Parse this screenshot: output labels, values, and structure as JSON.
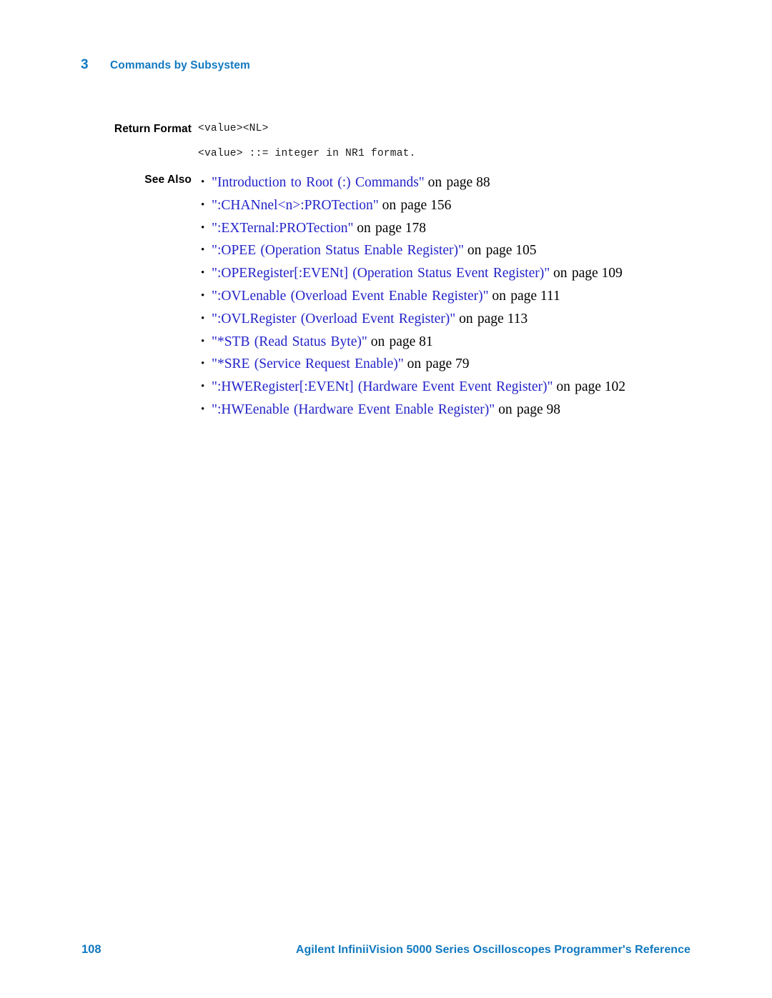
{
  "header": {
    "chapter_number": "3",
    "chapter_title": "Commands by Subsystem",
    "color": "#1179c0"
  },
  "sections": {
    "return_format": {
      "label": "Return Format",
      "lines": [
        "<value><NL>",
        "<value> ::= integer in NR1 format."
      ]
    },
    "see_also": {
      "label": "See Also",
      "bullet_glyph": "•",
      "link_color": "#2323c8",
      "items": [
        {
          "link": "\"Introduction to Root (:) Commands\"",
          "suffix": "on page",
          "page": "88"
        },
        {
          "link": "\":CHANnel<n>:PROTection\"",
          "suffix": "on page",
          "page": "156"
        },
        {
          "link": "\":EXTernal:PROTection\"",
          "suffix": "on page",
          "page": "178"
        },
        {
          "link": "\":OPEE (Operation Status Enable Register)\"",
          "suffix": "on page",
          "page": "105"
        },
        {
          "link": "\":OPERegister[:EVENt] (Operation Status Event Register)\"",
          "suffix": "on page",
          "page": "109"
        },
        {
          "link": "\":OVLenable (Overload Event Enable Register)\"",
          "suffix": "on page",
          "page": "111"
        },
        {
          "link": "\":OVLRegister (Overload Event Register)\"",
          "suffix": "on page",
          "page": "113"
        },
        {
          "link": "\"*STB (Read Status Byte)\"",
          "suffix": "on page",
          "page": "81"
        },
        {
          "link": "\"*SRE (Service Request Enable)\"",
          "suffix": "on page",
          "page": "79"
        },
        {
          "link": "\":HWERegister[:EVENt] (Hardware Event Event Register)\"",
          "suffix": "on page",
          "page": "102"
        },
        {
          "link": "\":HWEenable (Hardware Event Enable Register)\"",
          "suffix": "on page",
          "page": "98"
        }
      ]
    }
  },
  "footer": {
    "page_number": "108",
    "book_title": "Agilent InfiniiVision 5000 Series Oscilloscopes Programmer's Reference",
    "color": "#1179c0"
  }
}
